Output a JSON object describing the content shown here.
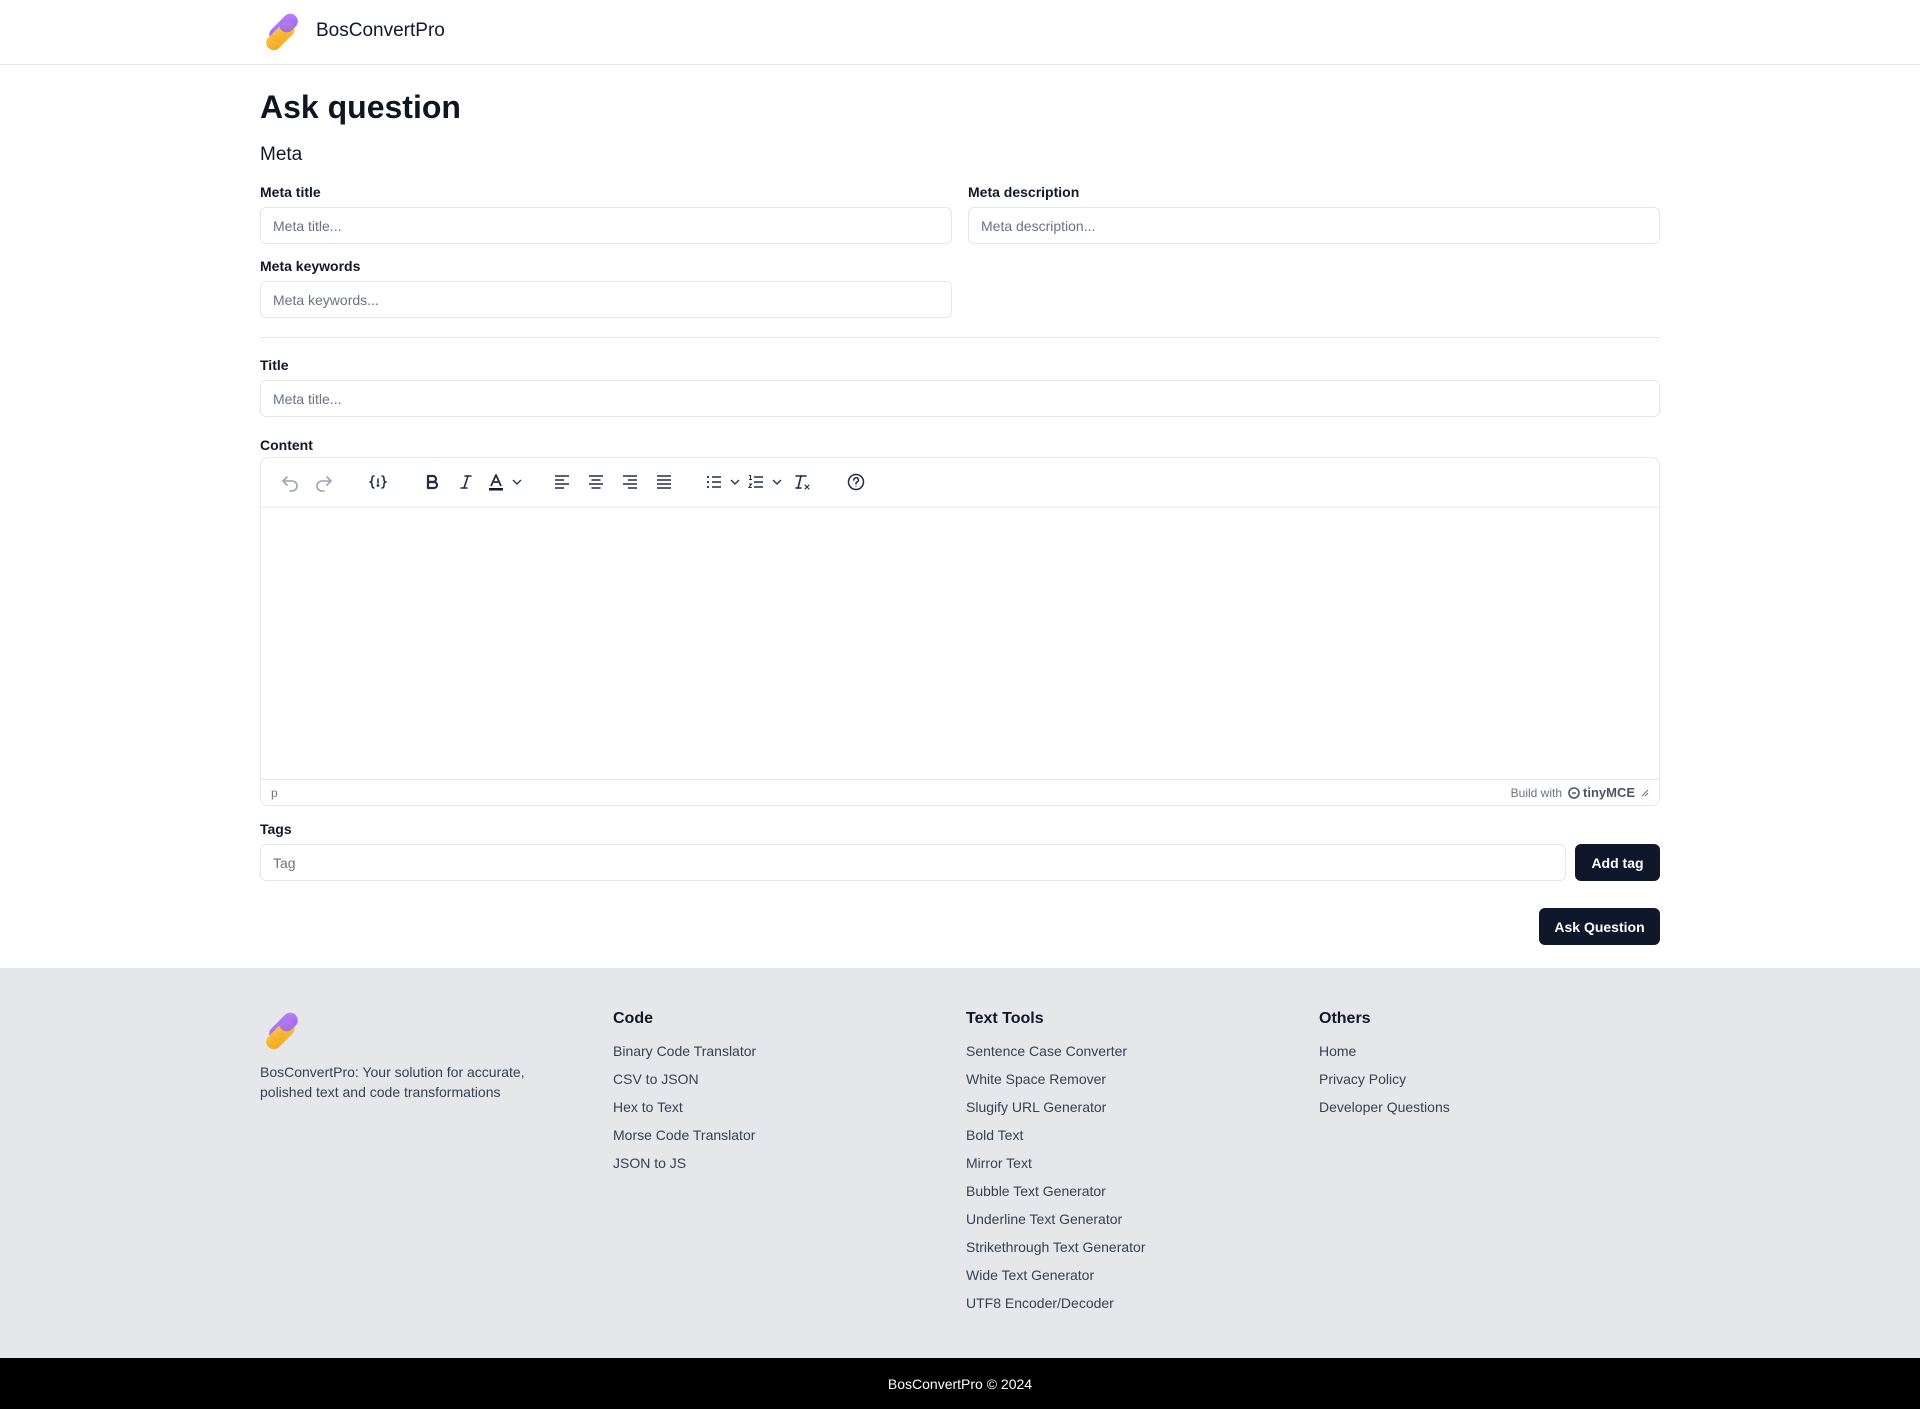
{
  "header": {
    "brand_name": "BosConvertPro"
  },
  "page": {
    "title": "Ask question",
    "meta_section_title": "Meta"
  },
  "form": {
    "meta_title": {
      "label": "Meta title",
      "placeholder": "Meta title...",
      "value": ""
    },
    "meta_description": {
      "label": "Meta description",
      "placeholder": "Meta description...",
      "value": ""
    },
    "meta_keywords": {
      "label": "Meta keywords",
      "placeholder": "Meta keywords...",
      "value": ""
    },
    "title": {
      "label": "Title",
      "placeholder": "Meta title...",
      "value": ""
    },
    "content": {
      "label": "Content"
    },
    "tags": {
      "label": "Tags",
      "placeholder": "Tag",
      "value": "",
      "add_button": "Add tag"
    },
    "submit_button": "Ask Question"
  },
  "editor": {
    "toolbar_icons": [
      "undo-icon",
      "redo-icon",
      "code-sample-icon",
      "bold-icon",
      "italic-icon",
      "text-color-icon",
      "align-left-icon",
      "align-center-icon",
      "align-right-icon",
      "align-justify-icon",
      "bullet-list-icon",
      "numbered-list-icon",
      "clear-formatting-icon",
      "help-icon"
    ],
    "status_path": "p",
    "build_with": "Build with",
    "brand": "tinyMCE"
  },
  "footer": {
    "description": "BosConvertPro: Your solution for accurate, polished text and code transformations",
    "columns": [
      {
        "title": "Code",
        "links": [
          "Binary Code Translator",
          "CSV to JSON",
          "Hex to Text",
          "Morse Code Translator",
          "JSON to JS"
        ]
      },
      {
        "title": "Text Tools",
        "links": [
          "Sentence Case Converter",
          "White Space Remover",
          "Slugify URL Generator",
          "Bold Text",
          "Mirror Text",
          "Bubble Text Generator",
          "Underline Text Generator",
          "Strikethrough Text Generator",
          "Wide Text Generator",
          "UTF8 Encoder/Decoder"
        ]
      },
      {
        "title": "Others",
        "links": [
          "Home",
          "Privacy Policy",
          "Developer Questions"
        ]
      }
    ],
    "copyright": "BosConvertPro © 2024"
  },
  "colors": {
    "primary_dark": "#0f172a",
    "footer_bg": "#e5e7eb",
    "bottom_bar_bg": "#000000",
    "logo_purple": "#a855f7",
    "logo_orange": "#fbbf24"
  }
}
